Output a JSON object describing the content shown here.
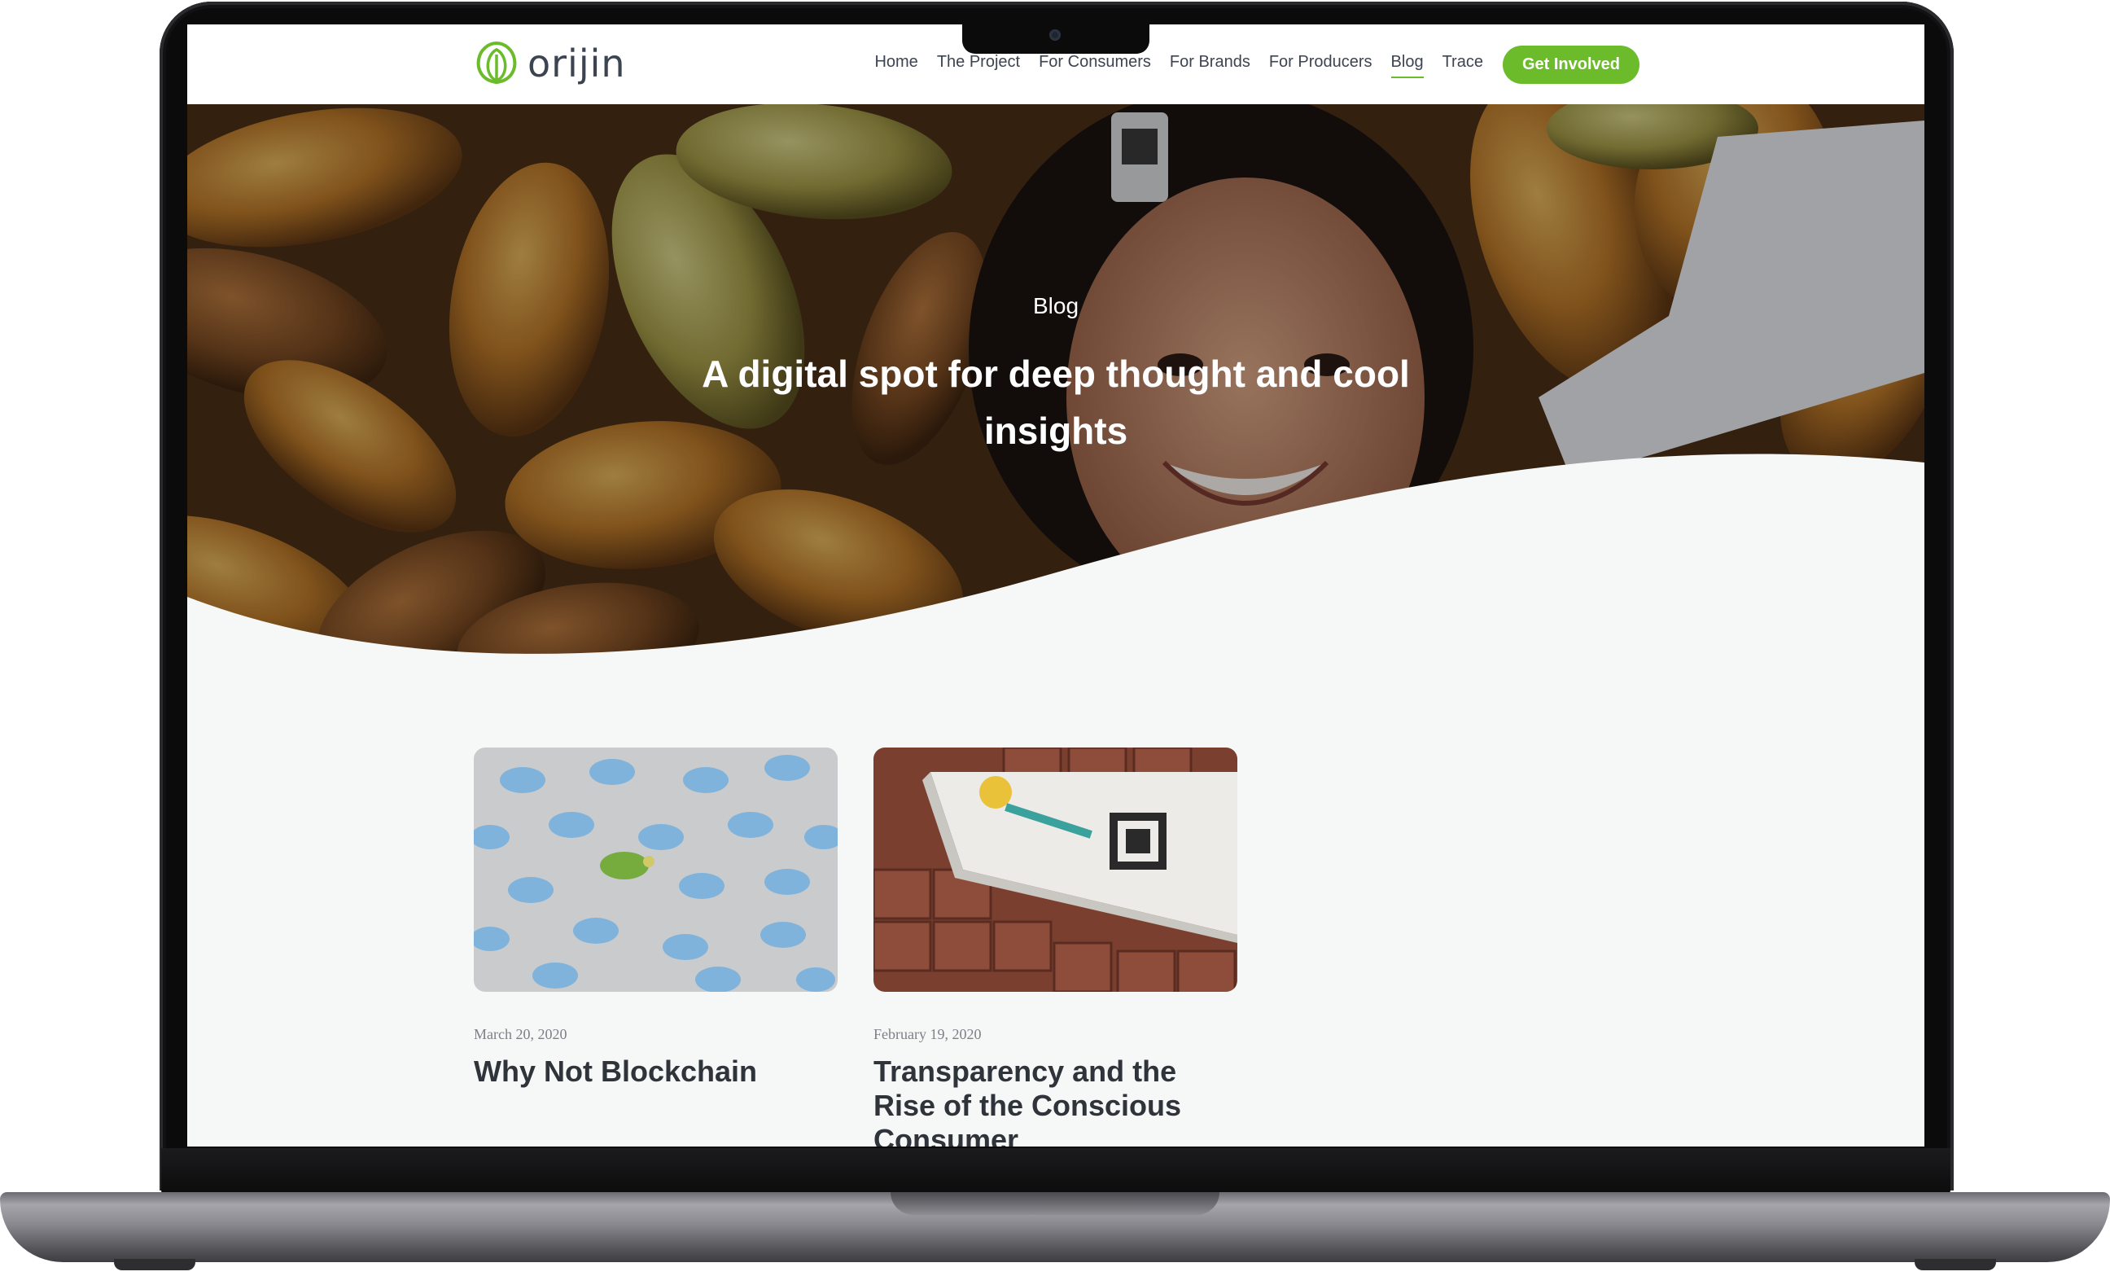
{
  "nav": {
    "logo_text": "orijin",
    "links": [
      {
        "label": "Home",
        "active": false
      },
      {
        "label": "The Project",
        "active": false
      },
      {
        "label": "For Consumers",
        "active": false
      },
      {
        "label": "For Brands",
        "active": false
      },
      {
        "label": "For Producers",
        "active": false
      },
      {
        "label": "Blog",
        "active": true
      },
      {
        "label": "Trace",
        "active": false
      }
    ],
    "cta_label": "Get Involved"
  },
  "hero": {
    "eyebrow": "Blog",
    "title": "A digital spot for deep thought and cool insights"
  },
  "posts": [
    {
      "date": "March 20, 2020",
      "title": "Why Not Blockchain"
    },
    {
      "date": "February 19, 2020",
      "title": "Transparency and the Rise of the Conscious Consumer"
    }
  ],
  "colors": {
    "accent": "#6bbb2a",
    "nav_text": "#3d4451",
    "page_bg": "#f6f8f7",
    "frame": "#0b0b0c",
    "base": "#8a8a90"
  }
}
